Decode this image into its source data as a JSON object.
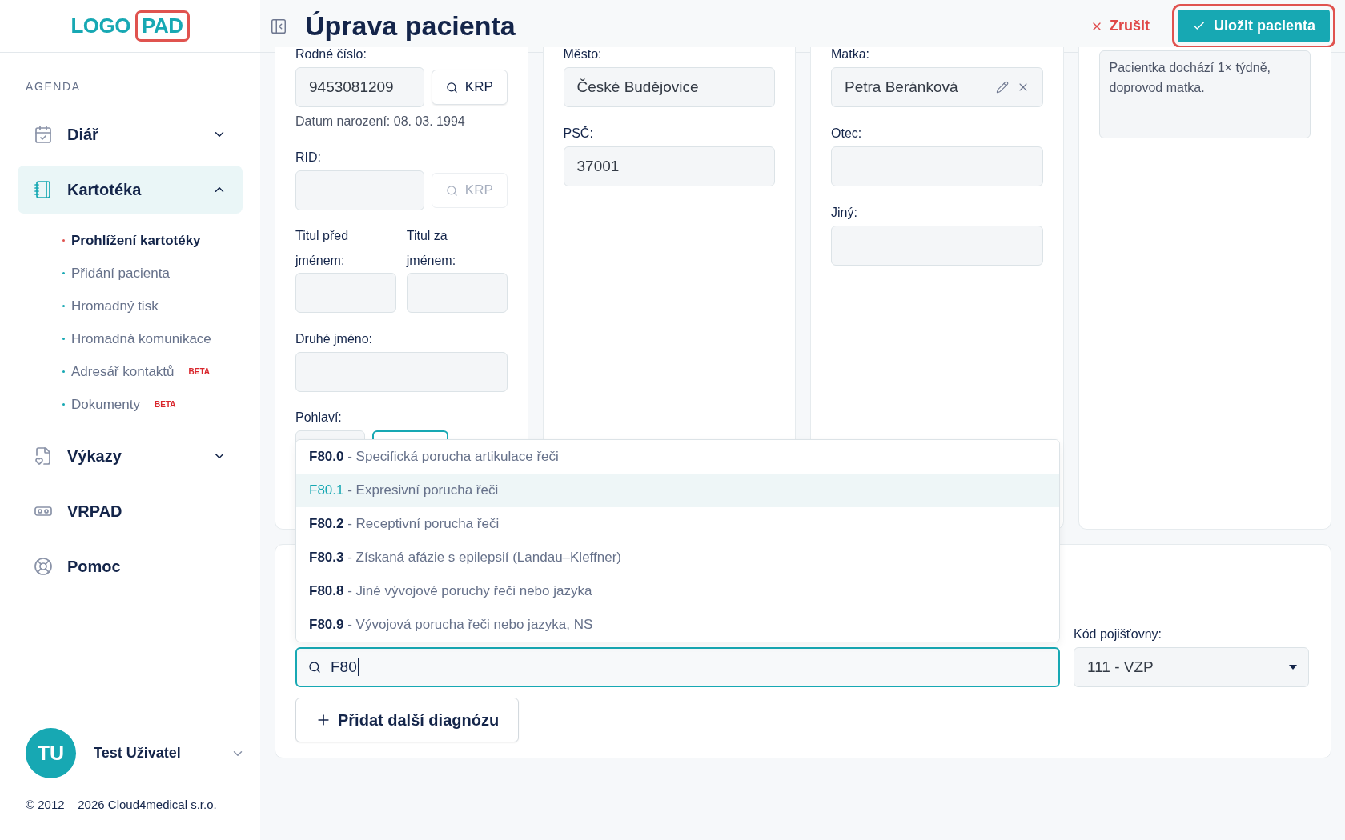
{
  "logo": {
    "parts": [
      {
        "text": "LOGO",
        "kind": "plain"
      },
      {
        "text": "PAD",
        "kind": "boxed"
      }
    ]
  },
  "sidebar": {
    "section_label": "AGENDA",
    "items": [
      {
        "label": "Diář",
        "kind": "calendar",
        "selected": false,
        "expanded": false
      },
      {
        "label": "Kartotéka",
        "kind": "cards",
        "selected": true,
        "expanded": true,
        "children": [
          {
            "label": "Prohlížení kartotéky",
            "selected": true
          },
          {
            "label": "Přidání pacienta",
            "selected": false
          },
          {
            "label": "Hromadný tisk",
            "selected": false
          },
          {
            "label": "Hromadná komunikace",
            "selected": false
          },
          {
            "label": "Adresář kontaktů",
            "selected": false,
            "badge": "BETA"
          },
          {
            "label": "Dokumenty",
            "selected": false,
            "badge": "BETA"
          }
        ]
      },
      {
        "label": "Výkazy",
        "kind": "report",
        "selected": false,
        "expanded": false
      },
      {
        "label": "VRPAD",
        "kind": "vr",
        "selected": false
      },
      {
        "label": "Pomoc",
        "kind": "help",
        "selected": false
      }
    ]
  },
  "user": {
    "initials": "TU",
    "name": "Test Uživatel"
  },
  "copyright": "© 2012 – 2026 Cloud4medical s.r.o.",
  "header": {
    "title": "Úprava pacienta",
    "cancel": "Zrušit",
    "save": {
      "label": "Uložit pacienta",
      "highlighted": true
    }
  },
  "identity": {
    "birth_number": {
      "label": "Rodné číslo:",
      "value": "9453081209",
      "lookup": {
        "label": "KRP",
        "disabled": false
      }
    },
    "birth_date": "Datum narození: 08. 03. 1994",
    "rid": {
      "label": "RID:",
      "lookup": {
        "label": "KRP",
        "disabled": true
      }
    },
    "titles": [
      {
        "label": "Titul před jménem:"
      },
      {
        "label": "Titul za jménem:"
      }
    ],
    "middle_name": {
      "label": "Druhé jméno:"
    },
    "gender": {
      "label": "Pohlaví:",
      "options": [
        {
          "selected": false
        },
        {
          "selected": true
        }
      ]
    }
  },
  "address": [
    {
      "label": "Město:",
      "value": "České Budějovice"
    },
    {
      "label": "PSČ:",
      "value": "37001"
    }
  ],
  "contacts": [
    {
      "label": "Matka:",
      "value": "Petra Beránková",
      "kind": "linked"
    },
    {
      "label": "Otec:",
      "kind": "input"
    },
    {
      "label": "Jiný:",
      "kind": "input"
    }
  ],
  "note": {
    "value": "Pacientka dochází 1× týdně, doprovod matka."
  },
  "diagnosis": {
    "search_value": "F80",
    "suggestions": [
      {
        "text": "**F80.0** - Specifická porucha artikulace řeči",
        "selected": false
      },
      {
        "text": "**F80.1** - Expresivní porucha řeči",
        "selected": true
      },
      {
        "text": "**F80.2** - Receptivní porucha řeči",
        "selected": false
      },
      {
        "text": "**F80.3** - Získaná afázie s epilepsií (Landau–Kleffner)",
        "selected": false
      },
      {
        "text": "**F80.8** - Jiné vývojové poruchy řeči nebo jazyka",
        "selected": false
      },
      {
        "text": "**F80.9** - Vývojová porucha řeči nebo jazyka, NS",
        "selected": false
      }
    ],
    "add_button": "Přidat další diagnózu"
  },
  "insurance": {
    "label": "Kód pojišťovny:",
    "value": "111 - VZP"
  }
}
